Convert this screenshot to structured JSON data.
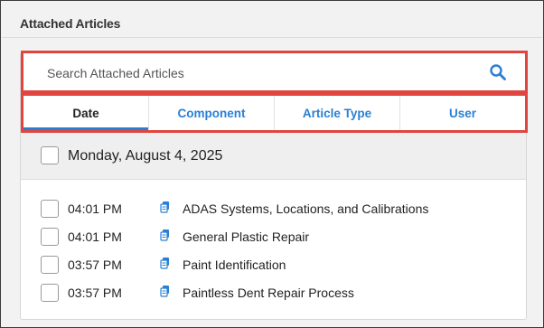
{
  "panel": {
    "title": "Attached Articles"
  },
  "search": {
    "placeholder": "Search Attached Articles",
    "icon": "search-icon"
  },
  "tabs": [
    {
      "label": "Date",
      "active": true
    },
    {
      "label": "Component",
      "active": false
    },
    {
      "label": "Article Type",
      "active": false
    },
    {
      "label": "User",
      "active": false
    }
  ],
  "group": {
    "date": "Monday, August 4, 2025",
    "articles": [
      {
        "time": "04:01 PM",
        "title": "ADAS Systems, Locations, and Calibrations",
        "icon": "article-icon"
      },
      {
        "time": "04:01 PM",
        "title": "General Plastic Repair",
        "icon": "article-icon"
      },
      {
        "time": "03:57 PM",
        "title": "Paint Identification",
        "icon": "article-icon"
      },
      {
        "time": "03:57 PM",
        "title": "Paintless Dent Repair Process",
        "icon": "article-icon"
      }
    ]
  },
  "colors": {
    "accent": "#2a7fd4",
    "highlight": "#e0463f"
  }
}
